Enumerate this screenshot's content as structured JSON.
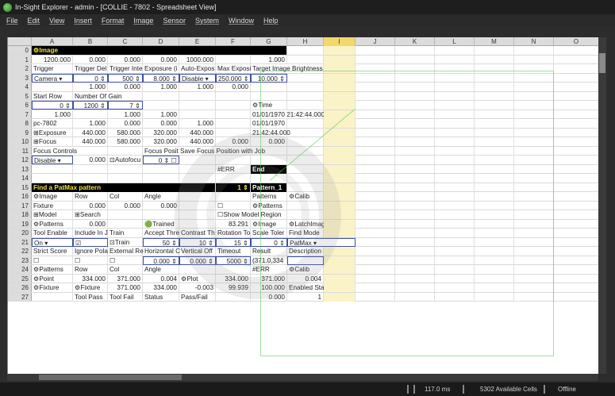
{
  "window": {
    "title": "In-Sight Explorer - admin - [COLLIE - 7802 - Spreadsheet View]"
  },
  "menu": [
    "File",
    "Edit",
    "View",
    "Insert",
    "Format",
    "Image",
    "Sensor",
    "System",
    "Window",
    "Help"
  ],
  "columns": [
    "A",
    "B",
    "C",
    "D",
    "E",
    "F",
    "G",
    "H",
    "I",
    "J",
    "K",
    "L",
    "M",
    "N",
    "O"
  ],
  "selected_column": "I",
  "rows": [
    {
      "n": "0",
      "cells": [
        {
          "t": "⚙Image",
          "s": "hdr",
          "span": 7
        }
      ]
    },
    {
      "n": "1",
      "cells": [
        {
          "t": "1200.000",
          "s": "num"
        },
        {
          "t": "0.000",
          "s": "num"
        },
        {
          "t": "0.000",
          "s": "num"
        },
        {
          "t": "0.000",
          "s": "num"
        },
        {
          "t": "1000.000",
          "s": "num"
        },
        {
          "t": ""
        },
        {
          "t": "1.000",
          "s": "num"
        }
      ]
    },
    {
      "n": "2",
      "cells": [
        {
          "t": "Trigger"
        },
        {
          "t": "Trigger Del"
        },
        {
          "t": "Trigger Inte"
        },
        {
          "t": "Exposure (i"
        },
        {
          "t": "Auto-Expos"
        },
        {
          "t": "Max Exposi"
        },
        {
          "t": "Target Image Brightness",
          "span": 2
        }
      ]
    },
    {
      "n": "3",
      "cells": [
        {
          "t": "Camera ▾",
          "s": "ctl"
        },
        {
          "t": "0 ⇕",
          "s": "ctl num"
        },
        {
          "t": "500 ⇕",
          "s": "ctl num"
        },
        {
          "t": "8.000 ⇕",
          "s": "ctl num"
        },
        {
          "t": "Disable ▾",
          "s": "ctl"
        },
        {
          "t": "250.000 ⇕",
          "s": "ctl num"
        },
        {
          "t": "10.000 ⇕",
          "s": "ctl num"
        }
      ]
    },
    {
      "n": "4",
      "cells": [
        {
          "t": ""
        },
        {
          "t": "1.000",
          "s": "num"
        },
        {
          "t": "0.000",
          "s": "num"
        },
        {
          "t": "1.000",
          "s": "num"
        },
        {
          "t": "1.000",
          "s": "num"
        },
        {
          "t": "0.000",
          "s": "num"
        }
      ]
    },
    {
      "n": "5",
      "cells": [
        {
          "t": "Start Row"
        },
        {
          "t": "Number Of Gain",
          "span": 2
        }
      ]
    },
    {
      "n": "6",
      "cells": [
        {
          "t": "0 ⇕",
          "s": "ctl num"
        },
        {
          "t": "1200 ⇕",
          "s": "ctl num"
        },
        {
          "t": "7 ⇕",
          "s": "ctl num"
        },
        {
          "t": ""
        },
        {
          "t": ""
        },
        {
          "t": ""
        },
        {
          "t": "⚙Time"
        }
      ]
    },
    {
      "n": "7",
      "cells": [
        {
          "t": "1.000",
          "s": "num"
        },
        {
          "t": ""
        },
        {
          "t": "1.000",
          "s": "num"
        },
        {
          "t": "1.000",
          "s": "num"
        },
        {
          "t": ""
        },
        {
          "t": ""
        },
        {
          "t": "01/01/1970 21:42:44.000",
          "span": 2
        }
      ]
    },
    {
      "n": "8",
      "cells": [
        {
          "t": "pc-7802"
        },
        {
          "t": "1.000",
          "s": "num"
        },
        {
          "t": "0.000",
          "s": "num"
        },
        {
          "t": "0.000",
          "s": "num"
        },
        {
          "t": "1.000",
          "s": "num"
        },
        {
          "t": ""
        },
        {
          "t": "01/01/1970"
        }
      ]
    },
    {
      "n": "9",
      "cells": [
        {
          "t": "⊞Exposure"
        },
        {
          "t": "440.000",
          "s": "num"
        },
        {
          "t": "580.000",
          "s": "num"
        },
        {
          "t": "320.000",
          "s": "num"
        },
        {
          "t": "440.000",
          "s": "num"
        },
        {
          "t": ""
        },
        {
          "t": "21:42:44.000"
        }
      ]
    },
    {
      "n": "10",
      "cells": [
        {
          "t": "⊞Focus"
        },
        {
          "t": "440.000",
          "s": "num"
        },
        {
          "t": "580.000",
          "s": "num"
        },
        {
          "t": "320.000",
          "s": "num"
        },
        {
          "t": "440.000",
          "s": "num"
        },
        {
          "t": "0.000",
          "s": "num"
        },
        {
          "t": "0.000",
          "s": "num"
        }
      ]
    },
    {
      "n": "11",
      "cells": [
        {
          "t": "Focus Controls",
          "span": 2
        },
        {
          "t": ""
        },
        {
          "t": "Focus Posit Save Focus Position with Job",
          "span": 4
        }
      ]
    },
    {
      "n": "12",
      "cells": [
        {
          "t": "Disable ▾",
          "s": "ctl"
        },
        {
          "t": "0.000",
          "s": "num"
        },
        {
          "t": "⊡Autofocu"
        },
        {
          "t": "0 ⇕ ☐",
          "s": "ctl num"
        }
      ]
    },
    {
      "n": "13",
      "cells": [
        {
          "t": ""
        },
        {
          "t": ""
        },
        {
          "t": ""
        },
        {
          "t": ""
        },
        {
          "t": ""
        },
        {
          "t": "#ERR"
        },
        {
          "t": "End",
          "s": "hdr white"
        }
      ]
    },
    {
      "n": "14",
      "cells": []
    },
    {
      "n": "15",
      "cells": [
        {
          "t": "Find a PatMax pattern",
          "s": "hdr",
          "span": 5
        },
        {
          "t": "1 ⇕",
          "s": "hdr num"
        },
        {
          "t": "Pattern_1",
          "s": "hdr white"
        }
      ]
    },
    {
      "n": "16",
      "cells": [
        {
          "t": "⚙Image"
        },
        {
          "t": "Row"
        },
        {
          "t": "Col"
        },
        {
          "t": "Angle"
        },
        {
          "t": ""
        },
        {
          "t": ""
        },
        {
          "t": "Patterns"
        },
        {
          "t": "⚙Calib"
        }
      ]
    },
    {
      "n": "17",
      "cells": [
        {
          "t": "Fixture"
        },
        {
          "t": "0.000",
          "s": "num"
        },
        {
          "t": "0.000",
          "s": "num"
        },
        {
          "t": "0.000",
          "s": "num"
        },
        {
          "t": ""
        },
        {
          "t": "☐"
        },
        {
          "t": "⚙Patterns"
        }
      ]
    },
    {
      "n": "18",
      "cells": [
        {
          "t": "⊞Model"
        },
        {
          "t": "⊞Search"
        },
        {
          "t": ""
        },
        {
          "t": ""
        },
        {
          "t": ""
        },
        {
          "t": "☐Show Model Region",
          "span": 2
        }
      ]
    },
    {
      "n": "19",
      "cells": [
        {
          "t": "⚙Patterns"
        },
        {
          "t": "0.000",
          "s": "num"
        },
        {
          "t": ""
        },
        {
          "t": "🟢Trained"
        },
        {
          "t": ""
        },
        {
          "t": "83.291",
          "s": "num"
        },
        {
          "t": "⚙Image"
        },
        {
          "t": "⚙LatchImage"
        }
      ]
    },
    {
      "n": "20",
      "cells": [
        {
          "t": "Tool Enable"
        },
        {
          "t": "Include In J"
        },
        {
          "t": "Train"
        },
        {
          "t": "Accept Thre"
        },
        {
          "t": "Contrast Th"
        },
        {
          "t": "Rotation To"
        },
        {
          "t": "Scale Toler"
        },
        {
          "t": "Find Mode"
        }
      ]
    },
    {
      "n": "21",
      "cells": [
        {
          "t": "On ▾",
          "s": "ctl"
        },
        {
          "t": "☑",
          "s": "ctl"
        },
        {
          "t": "⊡Train"
        },
        {
          "t": "50 ⇕",
          "s": "ctl num"
        },
        {
          "t": "10 ⇕",
          "s": "ctl num"
        },
        {
          "t": "15 ⇕",
          "s": "ctl num"
        },
        {
          "t": "0 ⇕",
          "s": "ctl num"
        },
        {
          "t": "PatMax ▾",
          "s": "ctl",
          "span": 2
        }
      ]
    },
    {
      "n": "22",
      "cells": [
        {
          "t": "Strict Score"
        },
        {
          "t": "Ignore Pola"
        },
        {
          "t": "External Re"
        },
        {
          "t": "Horizontal C"
        },
        {
          "t": "Vertical Off"
        },
        {
          "t": "Timeout"
        },
        {
          "t": "Result"
        },
        {
          "t": "Description"
        }
      ]
    },
    {
      "n": "23",
      "cells": [
        {
          "t": "☐"
        },
        {
          "t": "☐"
        },
        {
          "t": "☐"
        },
        {
          "t": "0.000 ⇕",
          "s": "ctl num"
        },
        {
          "t": "0.000 ⇕",
          "s": "ctl num"
        },
        {
          "t": "5000 ⇕",
          "s": "ctl num"
        },
        {
          "t": "(371.0,334"
        },
        {
          "t": "",
          "s": "ctl"
        }
      ]
    },
    {
      "n": "24",
      "cells": [
        {
          "t": "⚙Patterns"
        },
        {
          "t": "Row"
        },
        {
          "t": "Col"
        },
        {
          "t": "Angle"
        },
        {
          "t": ""
        },
        {
          "t": ""
        },
        {
          "t": "#ERR"
        },
        {
          "t": "⚙Calib"
        }
      ]
    },
    {
      "n": "25",
      "cells": [
        {
          "t": "⚙Point"
        },
        {
          "t": "334.000",
          "s": "num"
        },
        {
          "t": "371.000",
          "s": "num"
        },
        {
          "t": "0.004",
          "s": "num"
        },
        {
          "t": "⚙Plot"
        },
        {
          "t": "334.000",
          "s": "num"
        },
        {
          "t": "371.000",
          "s": "num"
        },
        {
          "t": "0.004",
          "s": "num"
        }
      ]
    },
    {
      "n": "26",
      "cells": [
        {
          "t": "⚙Fixture"
        },
        {
          "t": "⚙Fixture"
        },
        {
          "t": "371.000",
          "s": "num"
        },
        {
          "t": "334.000",
          "s": "num"
        },
        {
          "t": "-0.003",
          "s": "num"
        },
        {
          "t": "99.939",
          "s": "num"
        },
        {
          "t": "100.000",
          "s": "num"
        },
        {
          "t": "Enabled Status"
        }
      ]
    },
    {
      "n": "27",
      "cells": [
        {
          "t": ""
        },
        {
          "t": "Tool Pass"
        },
        {
          "t": "Tool Fail"
        },
        {
          "t": "Status"
        },
        {
          "t": "Pass/Fail"
        },
        {
          "t": ""
        },
        {
          "t": "0.000",
          "s": "num"
        },
        {
          "t": "1",
          "s": "num"
        }
      ]
    }
  ],
  "status": {
    "time": "117.0 ms",
    "cells": "5302 Available Cells",
    "mode": "Offline"
  },
  "colors": {
    "header_bg": "#000000",
    "header_text": "#f0e040",
    "control_border": "#3b4fa8",
    "selected_col": "#f2d86a"
  }
}
